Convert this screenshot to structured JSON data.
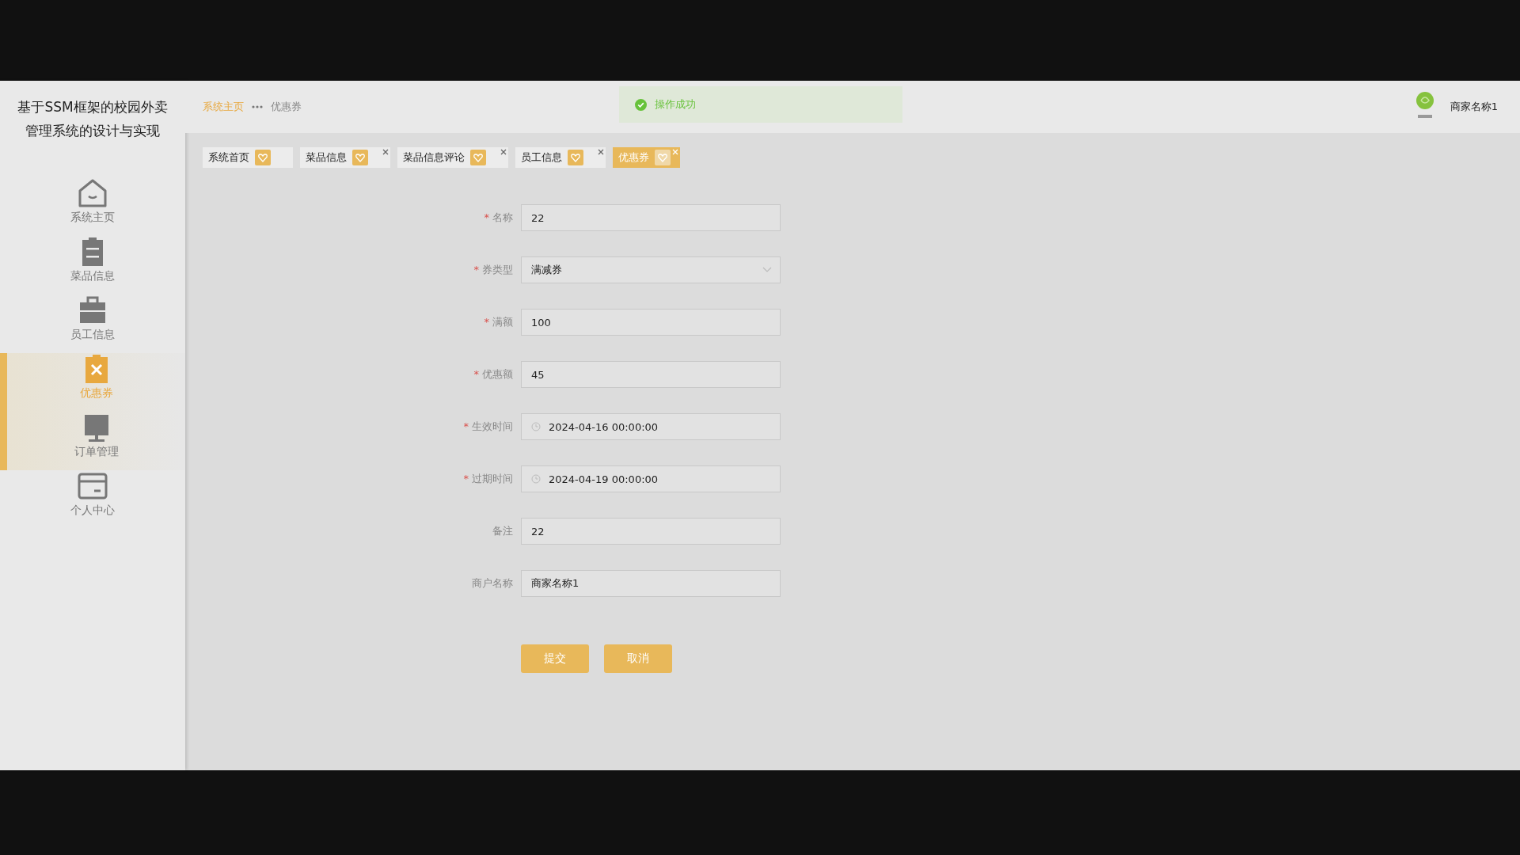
{
  "sidebar": {
    "title": "基于SSM框架的校园外卖管理系统的设计与实现",
    "items": [
      {
        "label": "系统主页",
        "selected": false,
        "hovered": false
      },
      {
        "label": "菜品信息",
        "selected": false,
        "hovered": false
      },
      {
        "label": "员工信息",
        "selected": false,
        "hovered": false
      },
      {
        "label": "优惠券",
        "selected": true,
        "hovered": false
      },
      {
        "label": "订单管理",
        "selected": false,
        "hovered": true
      },
      {
        "label": "个人中心",
        "selected": false,
        "hovered": false
      }
    ]
  },
  "breadcrumb": [
    {
      "label": "系统主页",
      "current": false
    },
    {
      "label": "优惠券",
      "current": true
    }
  ],
  "toast": {
    "message": "操作成功"
  },
  "user": {
    "name": "商家名称1"
  },
  "tabs": [
    {
      "label": "系统首页",
      "closable": false,
      "selected": false
    },
    {
      "label": "菜品信息",
      "closable": true,
      "selected": false
    },
    {
      "label": "菜品信息评论",
      "closable": true,
      "selected": false
    },
    {
      "label": "员工信息",
      "closable": true,
      "selected": false
    },
    {
      "label": "优惠券",
      "closable": true,
      "selected": true
    }
  ],
  "form": {
    "fields": [
      {
        "label": "名称",
        "required_mark": "*",
        "kind": "text",
        "value": "22"
      },
      {
        "label": "券类型",
        "required_mark": "*",
        "kind": "select",
        "value": "满减券"
      },
      {
        "label": "满额",
        "required_mark": "*",
        "kind": "text",
        "value": "100"
      },
      {
        "label": "优惠额",
        "required_mark": "*",
        "kind": "text",
        "value": "45"
      },
      {
        "label": "生效时间",
        "required_mark": "*",
        "kind": "date",
        "value": "2024-04-16 00:00:00"
      },
      {
        "label": "过期时间",
        "required_mark": "*",
        "kind": "date",
        "value": "2024-04-19 00:00:00"
      },
      {
        "label": "备注",
        "kind": "text",
        "value": "22"
      },
      {
        "label": "商户名称",
        "kind": "text",
        "value": "商家名称1"
      }
    ],
    "buttons": [
      "提交",
      "取消"
    ]
  }
}
